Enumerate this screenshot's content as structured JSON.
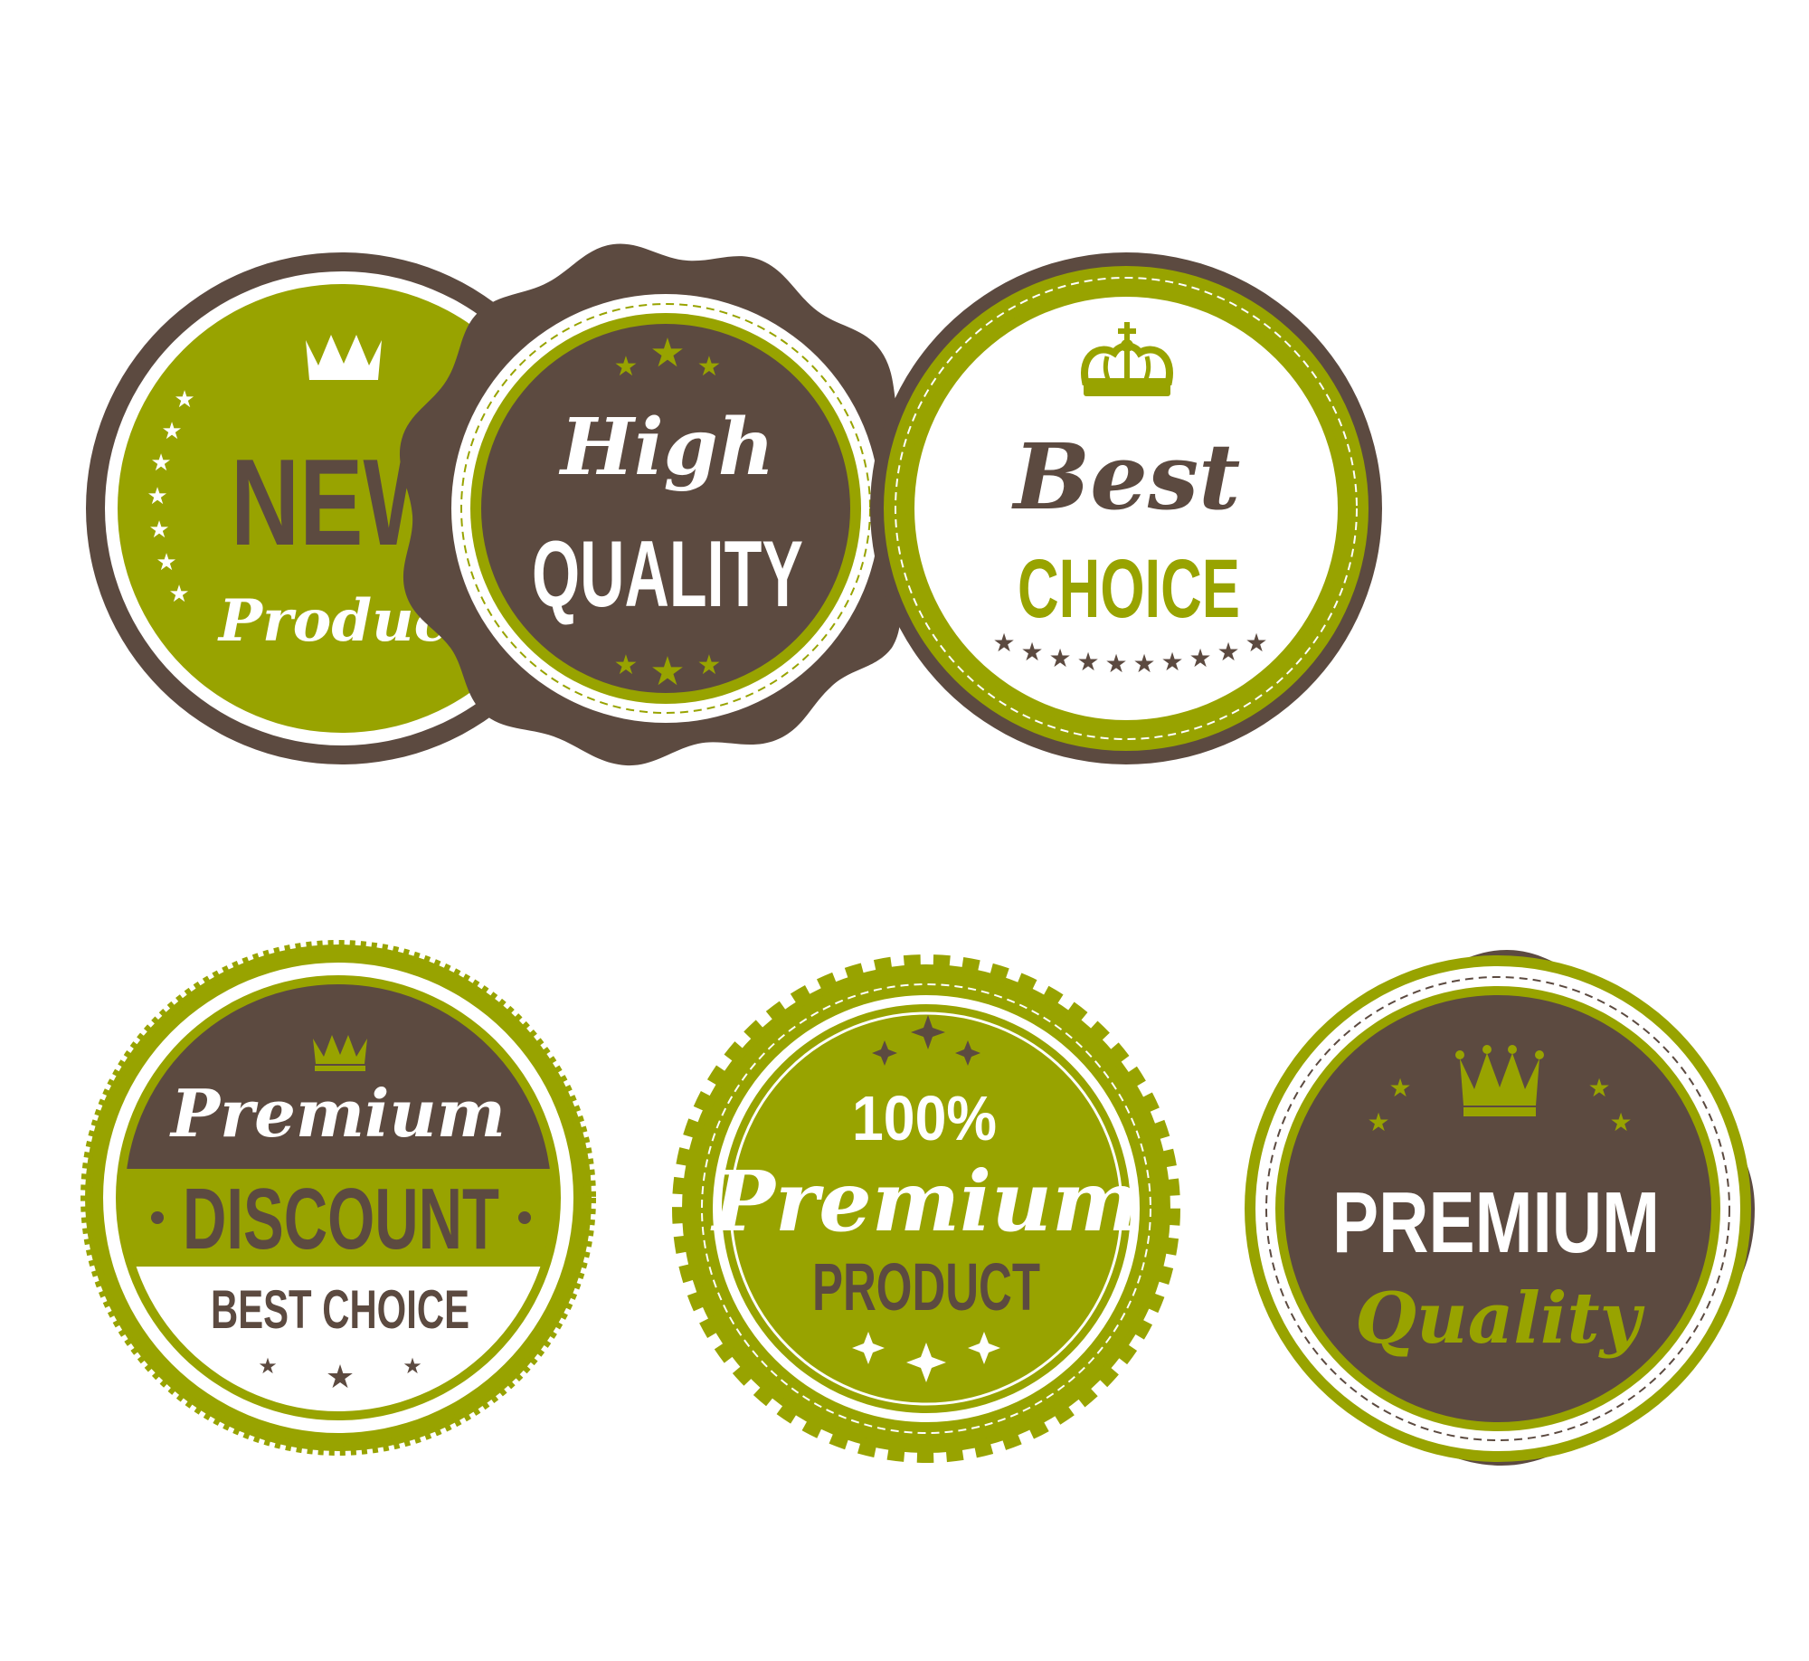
{
  "colors": {
    "green": "#98a300",
    "brown": "#5c4a40",
    "white": "#ffffff"
  },
  "badges": [
    {
      "id": "new-product",
      "icon": "crown-icon",
      "line1": "NEW",
      "line2": "Product"
    },
    {
      "id": "high-quality",
      "icon": "star-icon",
      "line1": "High",
      "line2": "QUALITY"
    },
    {
      "id": "best-choice",
      "icon": "royal-crown-icon",
      "line1": "Best",
      "line2": "CHOICE"
    },
    {
      "id": "premium-discount",
      "icon": "crown-icon",
      "line1": "Premium",
      "line2": "DISCOUNT",
      "line3": "BEST CHOICE"
    },
    {
      "id": "premium-product",
      "icon": "sparkle-star-icon",
      "line1": "100%",
      "line2": "Premium",
      "line3": "PRODUCT"
    },
    {
      "id": "premium-quality",
      "icon": "crown-icon",
      "line1": "PREMIUM",
      "line2": "Quality"
    }
  ]
}
